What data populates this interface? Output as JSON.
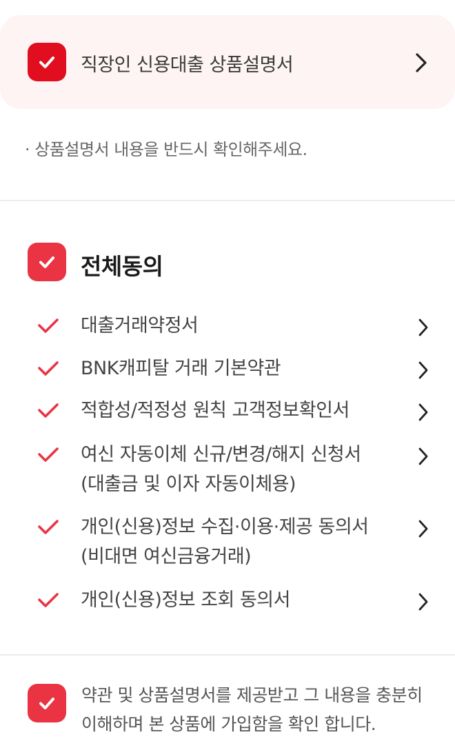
{
  "product": {
    "title": "직장인 신용대출 상품설명서",
    "notice": "·  상품설명서 내용을 반드시 확인해주세요."
  },
  "agree_all": {
    "label": "전체동의"
  },
  "terms": [
    {
      "line1": "대출거래약정서",
      "line2": ""
    },
    {
      "line1": "BNK캐피탈 거래 기본약관",
      "line2": ""
    },
    {
      "line1": "적합성/적정성 원칙 고객정보확인서",
      "line2": ""
    },
    {
      "line1": "여신 자동이체 신규/변경/해지 신청서",
      "line2": "(대출금 및 이자 자동이체용)"
    },
    {
      "line1": "개인(신용)정보 수집·이용·제공 동의서",
      "line2": "(비대면 여신금융거래)"
    },
    {
      "line1": "개인(신용)정보 조회 동의서",
      "line2": ""
    }
  ],
  "confirm": {
    "text": "약관 및 상품설명서를 제공받고 그 내용을 충분히 이해하며 본 상품에 가입함을 확인 합니다."
  },
  "colors": {
    "accent": "#ea3343",
    "accent_dark": "#e00e1e",
    "card_bg": "#fdf4f3"
  },
  "icons": {
    "checkbox": "checkbox-checked-icon",
    "check": "check-icon",
    "chevron": "chevron-right-icon"
  }
}
